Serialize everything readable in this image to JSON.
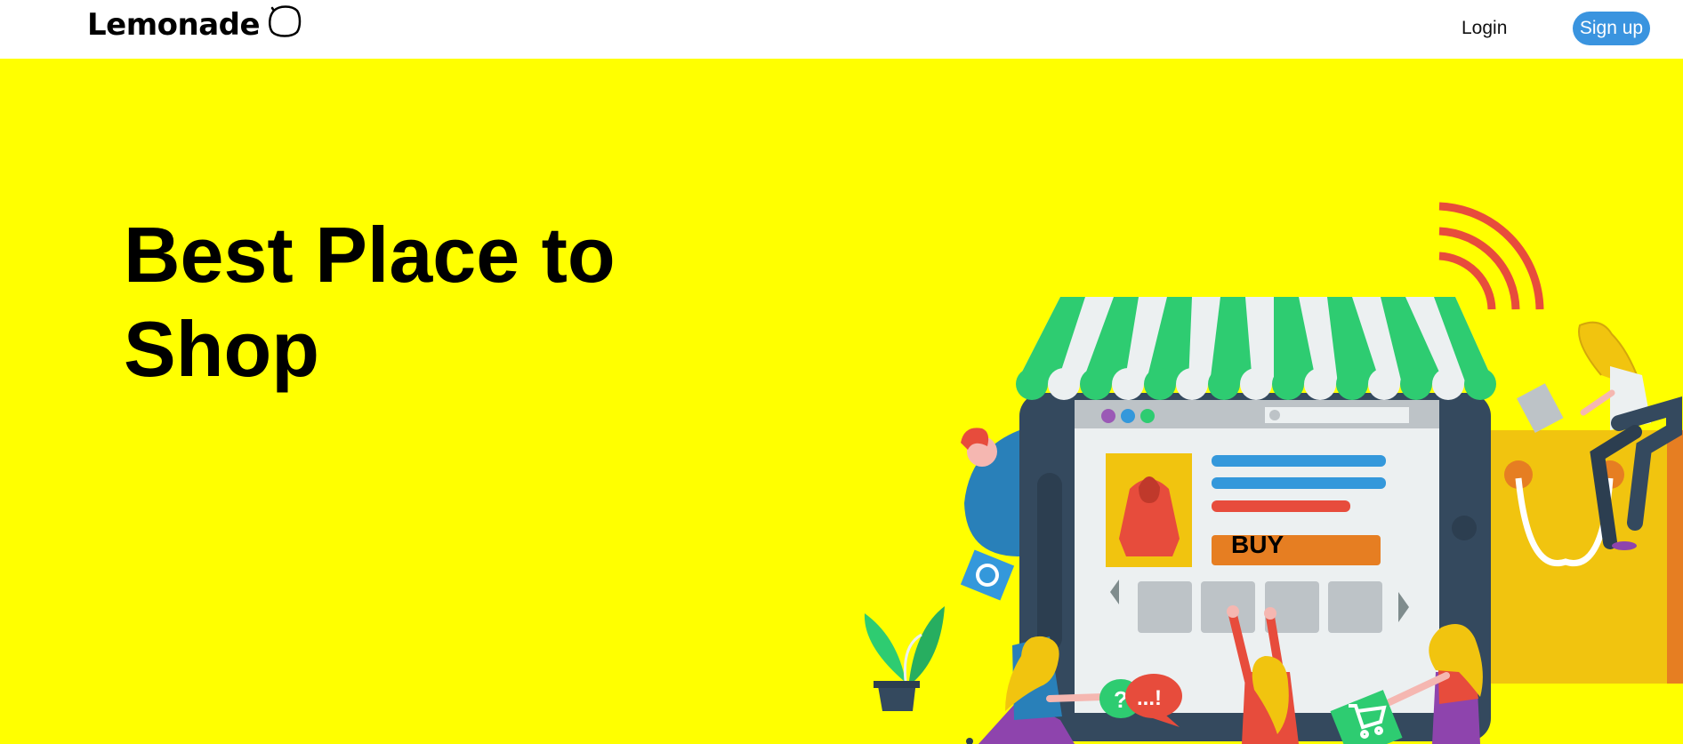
{
  "navbar": {
    "brand_name": "Lemonade",
    "login_label": "Login",
    "signup_label": "Sign up"
  },
  "hero": {
    "title": "Best Place to Shop",
    "illustration": {
      "buy_label": "BUY",
      "bubble_question": "?",
      "bubble_exclaim": "...!"
    }
  },
  "colors": {
    "hero_background": "#ffff00",
    "signup_button": "#3a94df",
    "awning_green": "#2ecc71",
    "awning_white": "#ecf0f1",
    "device_frame": "#34495e",
    "accent_red": "#e74c3c",
    "accent_orange": "#e67e22",
    "accent_blue": "#3498db"
  }
}
